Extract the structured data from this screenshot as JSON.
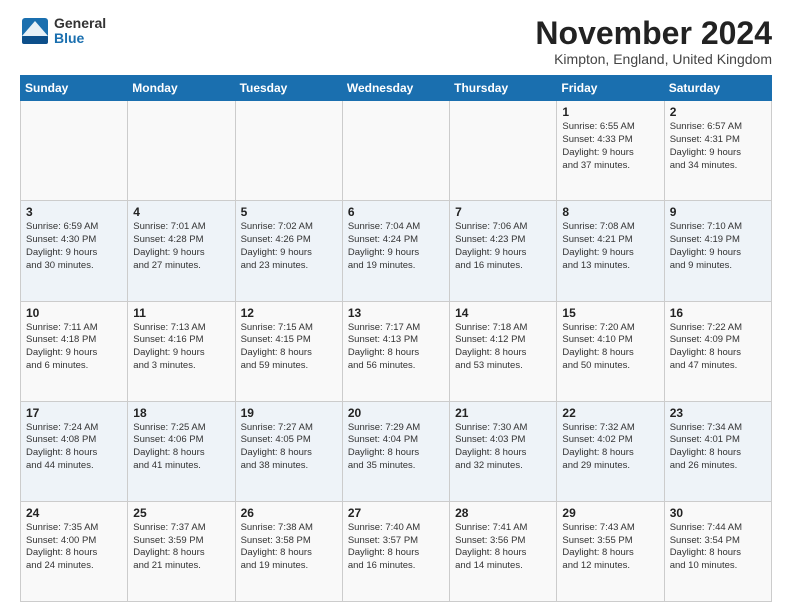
{
  "logo": {
    "general": "General",
    "blue": "Blue"
  },
  "title": "November 2024",
  "location": "Kimpton, England, United Kingdom",
  "days_of_week": [
    "Sunday",
    "Monday",
    "Tuesday",
    "Wednesday",
    "Thursday",
    "Friday",
    "Saturday"
  ],
  "weeks": [
    [
      {
        "day": "",
        "info": ""
      },
      {
        "day": "",
        "info": ""
      },
      {
        "day": "",
        "info": ""
      },
      {
        "day": "",
        "info": ""
      },
      {
        "day": "",
        "info": ""
      },
      {
        "day": "1",
        "info": "Sunrise: 6:55 AM\nSunset: 4:33 PM\nDaylight: 9 hours\nand 37 minutes."
      },
      {
        "day": "2",
        "info": "Sunrise: 6:57 AM\nSunset: 4:31 PM\nDaylight: 9 hours\nand 34 minutes."
      }
    ],
    [
      {
        "day": "3",
        "info": "Sunrise: 6:59 AM\nSunset: 4:30 PM\nDaylight: 9 hours\nand 30 minutes."
      },
      {
        "day": "4",
        "info": "Sunrise: 7:01 AM\nSunset: 4:28 PM\nDaylight: 9 hours\nand 27 minutes."
      },
      {
        "day": "5",
        "info": "Sunrise: 7:02 AM\nSunset: 4:26 PM\nDaylight: 9 hours\nand 23 minutes."
      },
      {
        "day": "6",
        "info": "Sunrise: 7:04 AM\nSunset: 4:24 PM\nDaylight: 9 hours\nand 19 minutes."
      },
      {
        "day": "7",
        "info": "Sunrise: 7:06 AM\nSunset: 4:23 PM\nDaylight: 9 hours\nand 16 minutes."
      },
      {
        "day": "8",
        "info": "Sunrise: 7:08 AM\nSunset: 4:21 PM\nDaylight: 9 hours\nand 13 minutes."
      },
      {
        "day": "9",
        "info": "Sunrise: 7:10 AM\nSunset: 4:19 PM\nDaylight: 9 hours\nand 9 minutes."
      }
    ],
    [
      {
        "day": "10",
        "info": "Sunrise: 7:11 AM\nSunset: 4:18 PM\nDaylight: 9 hours\nand 6 minutes."
      },
      {
        "day": "11",
        "info": "Sunrise: 7:13 AM\nSunset: 4:16 PM\nDaylight: 9 hours\nand 3 minutes."
      },
      {
        "day": "12",
        "info": "Sunrise: 7:15 AM\nSunset: 4:15 PM\nDaylight: 8 hours\nand 59 minutes."
      },
      {
        "day": "13",
        "info": "Sunrise: 7:17 AM\nSunset: 4:13 PM\nDaylight: 8 hours\nand 56 minutes."
      },
      {
        "day": "14",
        "info": "Sunrise: 7:18 AM\nSunset: 4:12 PM\nDaylight: 8 hours\nand 53 minutes."
      },
      {
        "day": "15",
        "info": "Sunrise: 7:20 AM\nSunset: 4:10 PM\nDaylight: 8 hours\nand 50 minutes."
      },
      {
        "day": "16",
        "info": "Sunrise: 7:22 AM\nSunset: 4:09 PM\nDaylight: 8 hours\nand 47 minutes."
      }
    ],
    [
      {
        "day": "17",
        "info": "Sunrise: 7:24 AM\nSunset: 4:08 PM\nDaylight: 8 hours\nand 44 minutes."
      },
      {
        "day": "18",
        "info": "Sunrise: 7:25 AM\nSunset: 4:06 PM\nDaylight: 8 hours\nand 41 minutes."
      },
      {
        "day": "19",
        "info": "Sunrise: 7:27 AM\nSunset: 4:05 PM\nDaylight: 8 hours\nand 38 minutes."
      },
      {
        "day": "20",
        "info": "Sunrise: 7:29 AM\nSunset: 4:04 PM\nDaylight: 8 hours\nand 35 minutes."
      },
      {
        "day": "21",
        "info": "Sunrise: 7:30 AM\nSunset: 4:03 PM\nDaylight: 8 hours\nand 32 minutes."
      },
      {
        "day": "22",
        "info": "Sunrise: 7:32 AM\nSunset: 4:02 PM\nDaylight: 8 hours\nand 29 minutes."
      },
      {
        "day": "23",
        "info": "Sunrise: 7:34 AM\nSunset: 4:01 PM\nDaylight: 8 hours\nand 26 minutes."
      }
    ],
    [
      {
        "day": "24",
        "info": "Sunrise: 7:35 AM\nSunset: 4:00 PM\nDaylight: 8 hours\nand 24 minutes."
      },
      {
        "day": "25",
        "info": "Sunrise: 7:37 AM\nSunset: 3:59 PM\nDaylight: 8 hours\nand 21 minutes."
      },
      {
        "day": "26",
        "info": "Sunrise: 7:38 AM\nSunset: 3:58 PM\nDaylight: 8 hours\nand 19 minutes."
      },
      {
        "day": "27",
        "info": "Sunrise: 7:40 AM\nSunset: 3:57 PM\nDaylight: 8 hours\nand 16 minutes."
      },
      {
        "day": "28",
        "info": "Sunrise: 7:41 AM\nSunset: 3:56 PM\nDaylight: 8 hours\nand 14 minutes."
      },
      {
        "day": "29",
        "info": "Sunrise: 7:43 AM\nSunset: 3:55 PM\nDaylight: 8 hours\nand 12 minutes."
      },
      {
        "day": "30",
        "info": "Sunrise: 7:44 AM\nSunset: 3:54 PM\nDaylight: 8 hours\nand 10 minutes."
      }
    ]
  ]
}
